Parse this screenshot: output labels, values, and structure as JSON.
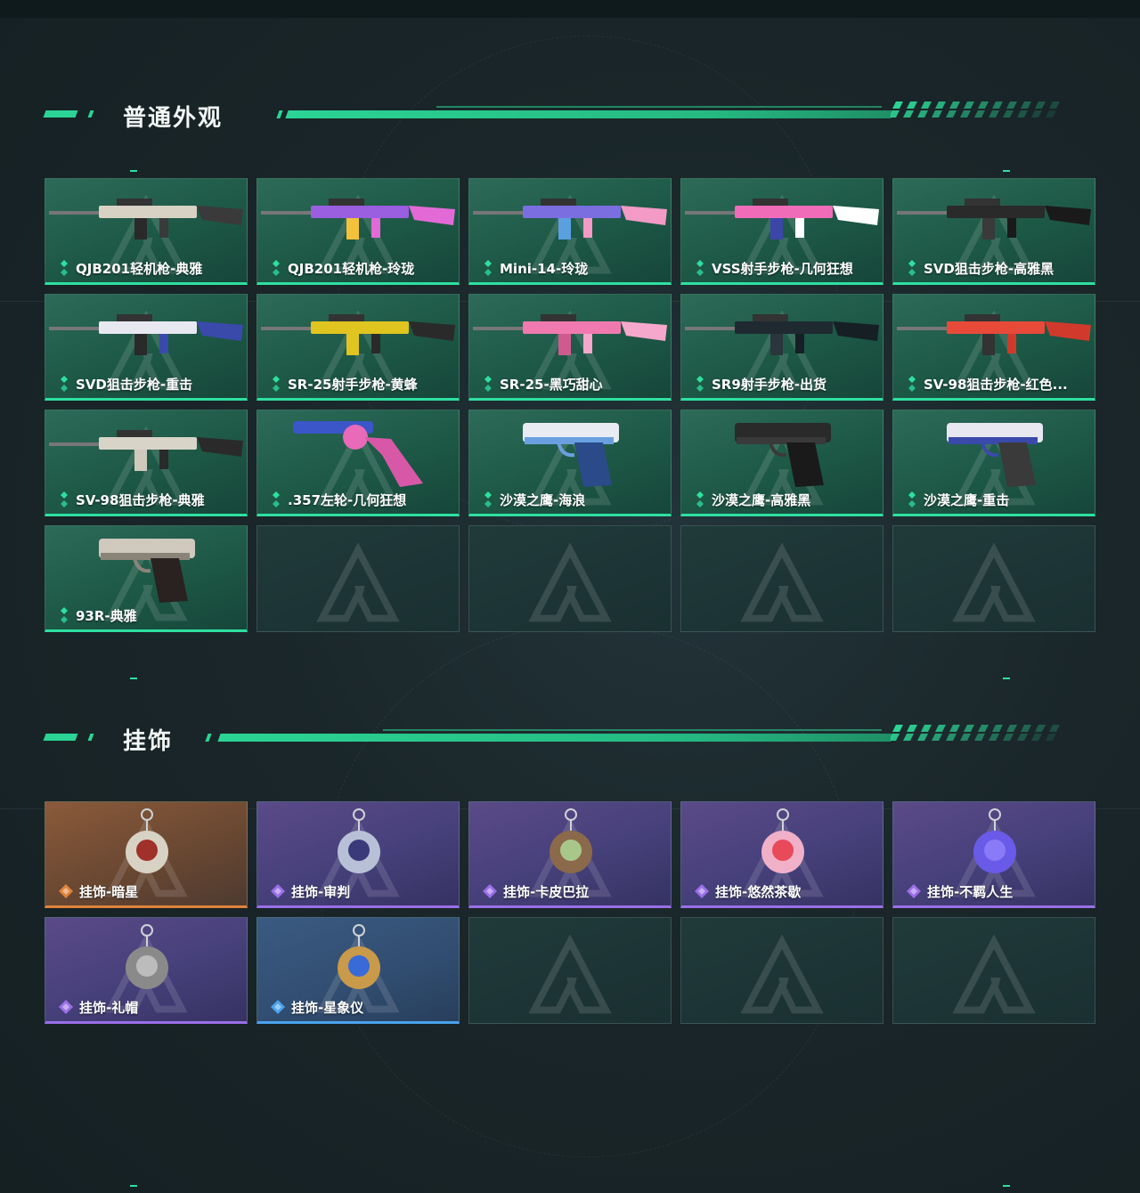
{
  "colors": {
    "accent": "#2bd494",
    "rarity_green": "#2ee0a0",
    "rarity_orange": "#e0823a",
    "rarity_purple": "#9a6ee8",
    "rarity_blue": "#4aa2ee",
    "background": "#1a2629"
  },
  "sections": [
    {
      "title": "普通外观",
      "items": [
        {
          "label": "QJB201轻机枪-典雅",
          "rarity": "green",
          "icon": "lmg-classic-icon"
        },
        {
          "label": "QJB201轻机枪-玲珑",
          "rarity": "green",
          "icon": "lmg-purple-icon"
        },
        {
          "label": "Mini-14-玲珑",
          "rarity": "green",
          "icon": "rifle-gradient-icon"
        },
        {
          "label": "VSS射手步枪-几何狂想",
          "rarity": "green",
          "icon": "vss-pink-icon"
        },
        {
          "label": "SVD狙击步枪-高雅黑",
          "rarity": "green",
          "icon": "svd-black-icon"
        },
        {
          "label": "SVD狙击步枪-重击",
          "rarity": "green",
          "icon": "svd-white-blue-icon"
        },
        {
          "label": "SR-25射手步枪-黄蜂",
          "rarity": "green",
          "icon": "sr25-yellow-icon"
        },
        {
          "label": "SR-25-黑巧甜心",
          "rarity": "green",
          "icon": "sr25-pink-icon"
        },
        {
          "label": "SR9射手步枪-出货",
          "rarity": "green",
          "icon": "sr9-dark-icon"
        },
        {
          "label": "SV-98狙击步枪-红色...",
          "rarity": "green",
          "icon": "sv98-red-icon"
        },
        {
          "label": "SV-98狙击步枪-典雅",
          "rarity": "green",
          "icon": "sv98-classic-icon"
        },
        {
          "label": ".357左轮-几何狂想",
          "rarity": "green",
          "icon": "revolver-pink-icon"
        },
        {
          "label": "沙漠之鹰-海浪",
          "rarity": "green",
          "icon": "deagle-wave-icon"
        },
        {
          "label": "沙漠之鹰-高雅黑",
          "rarity": "green",
          "icon": "deagle-black-icon"
        },
        {
          "label": "沙漠之鹰-重击",
          "rarity": "green",
          "icon": "deagle-white-icon"
        },
        {
          "label": "93R-典雅",
          "rarity": "green",
          "icon": "pistol-93r-icon"
        }
      ],
      "empty_slots": 4
    },
    {
      "title": "挂饰",
      "items": [
        {
          "label": "挂饰-暗星",
          "rarity": "orange",
          "icon": "charm-feather-icon"
        },
        {
          "label": "挂饰-审判",
          "rarity": "purple",
          "icon": "charm-card-icon"
        },
        {
          "label": "挂饰-卡皮巴拉",
          "rarity": "purple",
          "icon": "charm-capybara-icon"
        },
        {
          "label": "挂饰-悠然茶歇",
          "rarity": "purple",
          "icon": "charm-cupcake-icon"
        },
        {
          "label": "挂饰-不羁人生",
          "rarity": "purple",
          "icon": "charm-sneaker-icon"
        },
        {
          "label": "挂饰-礼帽",
          "rarity": "purple",
          "icon": "charm-hat-icon"
        },
        {
          "label": "挂饰-星象仪",
          "rarity": "blue",
          "icon": "charm-astrolabe-icon"
        }
      ],
      "empty_slots": 3
    }
  ]
}
